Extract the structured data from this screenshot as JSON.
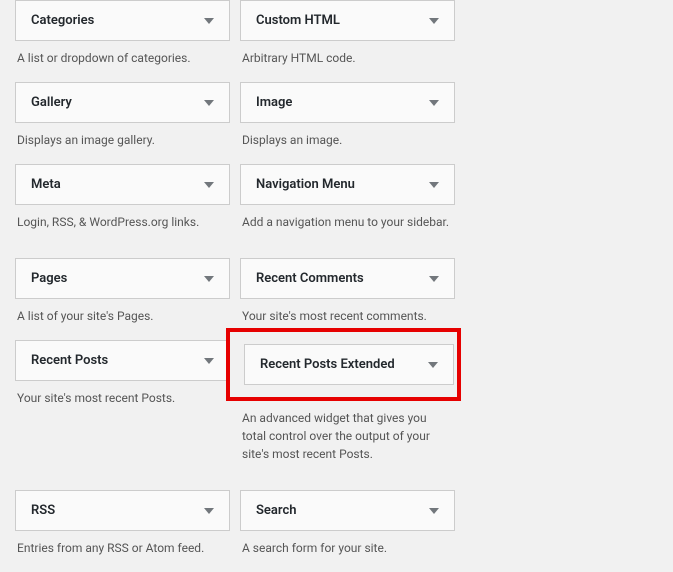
{
  "widgets": [
    {
      "left": {
        "title": "Categories",
        "description": "A list or dropdown of categories."
      },
      "right": {
        "title": "Custom HTML",
        "description": "Arbitrary HTML code."
      }
    },
    {
      "left": {
        "title": "Gallery",
        "description": "Displays an image gallery."
      },
      "right": {
        "title": "Image",
        "description": "Displays an image."
      }
    },
    {
      "left": {
        "title": "Meta",
        "description": "Login, RSS, & WordPress.org links."
      },
      "right": {
        "title": "Navigation Menu",
        "description": "Add a navigation menu to your sidebar."
      }
    },
    {
      "left": {
        "title": "Pages",
        "description": "A list of your site's Pages."
      },
      "right": {
        "title": "Recent Comments",
        "description": "Your site's most recent comments."
      }
    },
    {
      "left": {
        "title": "Recent Posts",
        "description": "Your site's most recent Posts."
      },
      "right": {
        "title": "Recent Posts Extended",
        "description": "An advanced widget that gives you total control over the output of your site's most recent Posts.",
        "highlighted": true
      }
    },
    {
      "left": {
        "title": "RSS",
        "description": "Entries from any RSS or Atom feed."
      },
      "right": {
        "title": "Search",
        "description": "A search form for your site."
      }
    }
  ]
}
